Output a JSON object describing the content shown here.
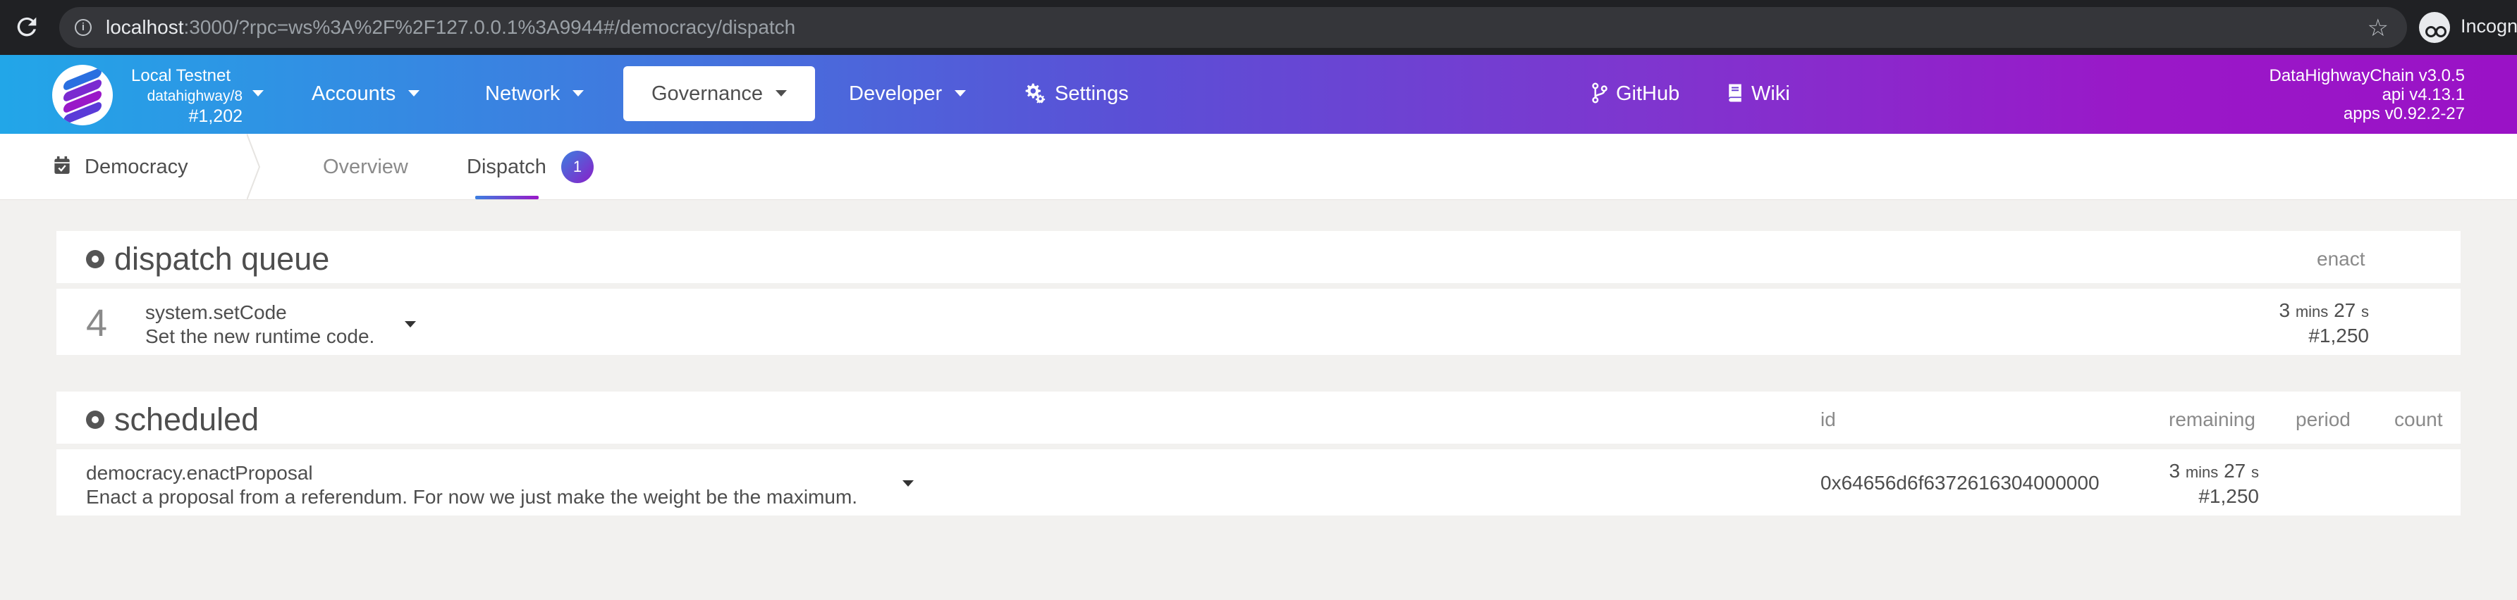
{
  "browser": {
    "url_host": "localhost",
    "url_rest": ":3000/?rpc=ws%3A%2F%2F127.0.0.1%3A9944#/democracy/dispatch",
    "profile_label": "Incognito"
  },
  "chain": {
    "name": "Local Testnet",
    "runtime": "datahighway/8",
    "block": "#1,202"
  },
  "nav": {
    "accounts": "Accounts",
    "network": "Network",
    "governance": "Governance",
    "developer": "Developer",
    "settings": "Settings",
    "github": "GitHub",
    "wiki": "Wiki"
  },
  "versions": {
    "chain": "DataHighwayChain v3.0.5",
    "api": "api v4.13.1",
    "apps": "apps v0.92.2-27"
  },
  "subnav": {
    "section": "Democracy",
    "tabs": [
      "Overview",
      "Dispatch"
    ],
    "badge": "1"
  },
  "dispatch_queue": {
    "title": "dispatch queue",
    "column_enact": "enact",
    "rows": [
      {
        "index": "4",
        "call": "system.setCode",
        "description": "Set the new runtime code.",
        "time_mins": "3",
        "time_mins_unit": "mins",
        "time_secs": "27",
        "time_secs_unit": "s",
        "block": "#1,250"
      }
    ]
  },
  "scheduled": {
    "title": "scheduled",
    "columns": {
      "id": "id",
      "remaining": "remaining",
      "period": "period",
      "count": "count"
    },
    "rows": [
      {
        "call": "democracy.enactProposal",
        "description": "Enact a proposal from a referendum. For now we just make the weight be the maximum.",
        "id": "0x64656d6f6372616304000000",
        "time_mins": "3",
        "time_mins_unit": "mins",
        "time_secs": "27",
        "time_secs_unit": "s",
        "block": "#1,250",
        "period": "",
        "count": ""
      }
    ]
  },
  "colors": {
    "nav_gradient_start": "#22a6e8",
    "nav_gradient_end": "#9a12c6",
    "page_bg": "#f2f1ef"
  }
}
